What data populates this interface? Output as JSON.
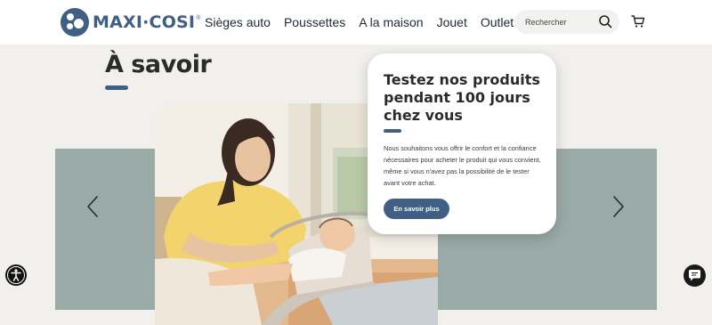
{
  "brand": {
    "name": "MAXI·COSI",
    "reg": "®",
    "color": "#3f5f83"
  },
  "nav": {
    "items": [
      {
        "label": "Sièges auto"
      },
      {
        "label": "Poussettes"
      },
      {
        "label": "A la maison"
      },
      {
        "label": "Jouet"
      },
      {
        "label": "Outlet"
      }
    ]
  },
  "search": {
    "placeholder": "Rechercher",
    "icon": "search-icon"
  },
  "cart": {
    "icon": "cart-icon"
  },
  "section": {
    "title": "À savoir"
  },
  "card": {
    "title": "Testez nos produits pendant 100 jours chez vous",
    "text": "Nous souhaitons vous offrir le confort et la confiance nécessaires pour acheter le produit qui vous convient, même si vous n'avez pas la possibilité de le tester avant votre achat.",
    "button_label": "En savoir plus"
  },
  "carousel": {
    "prev_icon": "chevron-left-icon",
    "next_icon": "chevron-right-icon",
    "background": "#9aaaa6"
  },
  "floating": {
    "accessibility_icon": "accessibility-icon",
    "chat_icon": "chat-icon"
  }
}
